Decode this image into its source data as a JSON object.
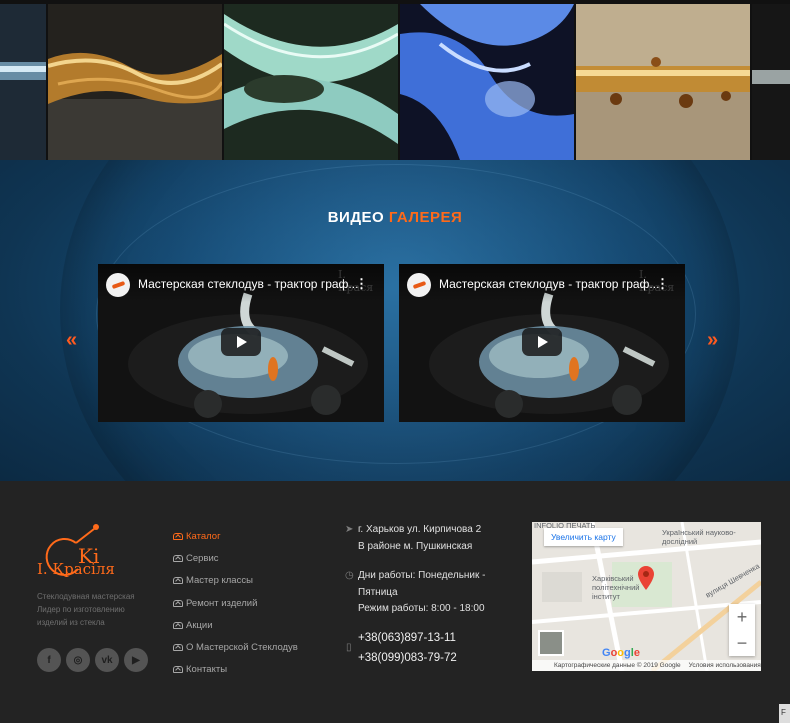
{
  "gallery": {
    "tiles": [
      {
        "name": "glass-tile-1"
      },
      {
        "name": "glass-tile-2"
      },
      {
        "name": "glass-tile-3"
      },
      {
        "name": "glass-tile-4"
      },
      {
        "name": "glass-tile-5"
      },
      {
        "name": "glass-tile-6"
      }
    ]
  },
  "video_gallery": {
    "title_word1": "ВИДЕО",
    "title_word2": "ГАЛЕРЕЯ",
    "prev_icon": "«",
    "next_icon": "»",
    "videos": [
      {
        "title": "Мастерская стеклодув - трактор граф...",
        "watermark": "I. Крася"
      },
      {
        "title": "Мастерская стеклодув - трактор граф...",
        "watermark": "I. Крася"
      }
    ]
  },
  "footer": {
    "logo_text": "І. Красіля",
    "tagline": "Стеклодувная мастерская Лидер по изготовлению изделий из стекла",
    "socials": [
      {
        "icon": "facebook-icon",
        "glyph": "f"
      },
      {
        "icon": "instagram-icon",
        "glyph": "◎"
      },
      {
        "icon": "vk-icon",
        "glyph": "vk"
      },
      {
        "icon": "youtube-icon",
        "glyph": "▶"
      }
    ],
    "menu": [
      {
        "label": "Каталог",
        "active": true
      },
      {
        "label": "Сервис"
      },
      {
        "label": "Мастер классы"
      },
      {
        "label": "Ремонт изделий"
      },
      {
        "label": "Акции"
      },
      {
        "label": "О Мастерской Стеклодув"
      },
      {
        "label": "Контакты"
      }
    ],
    "address_line1": "г. Харьков ул. Кирпичова 2",
    "address_line2": "В районе м. Пушкинская",
    "hours_line1": "Дни работы: Понедельник -",
    "hours_line2": "Пятница",
    "hours_line3": "Режим работы: 8:00 - 18:00",
    "phone1": "+38(063)897-13-11",
    "phone2": "+38(099)083-79-72"
  },
  "map": {
    "enlarge_label": "Увеличить карту",
    "label_institute": "Харківський політехнічний інститут",
    "label_museum": "Український науково-дослідний",
    "label_street": "вулиця Шевченка",
    "label_top": "INFOLIO ПЕЧАТЬ",
    "zoom_in": "+",
    "zoom_out": "−",
    "attribution": "Картографические данные © 2019 Google",
    "terms": "Условия использования",
    "google": [
      "G",
      "o",
      "o",
      "g",
      "l",
      "e"
    ]
  },
  "colors": {
    "accent": "#ff6a1a",
    "footer_bg": "#232323",
    "section_blue": "#154a72"
  }
}
